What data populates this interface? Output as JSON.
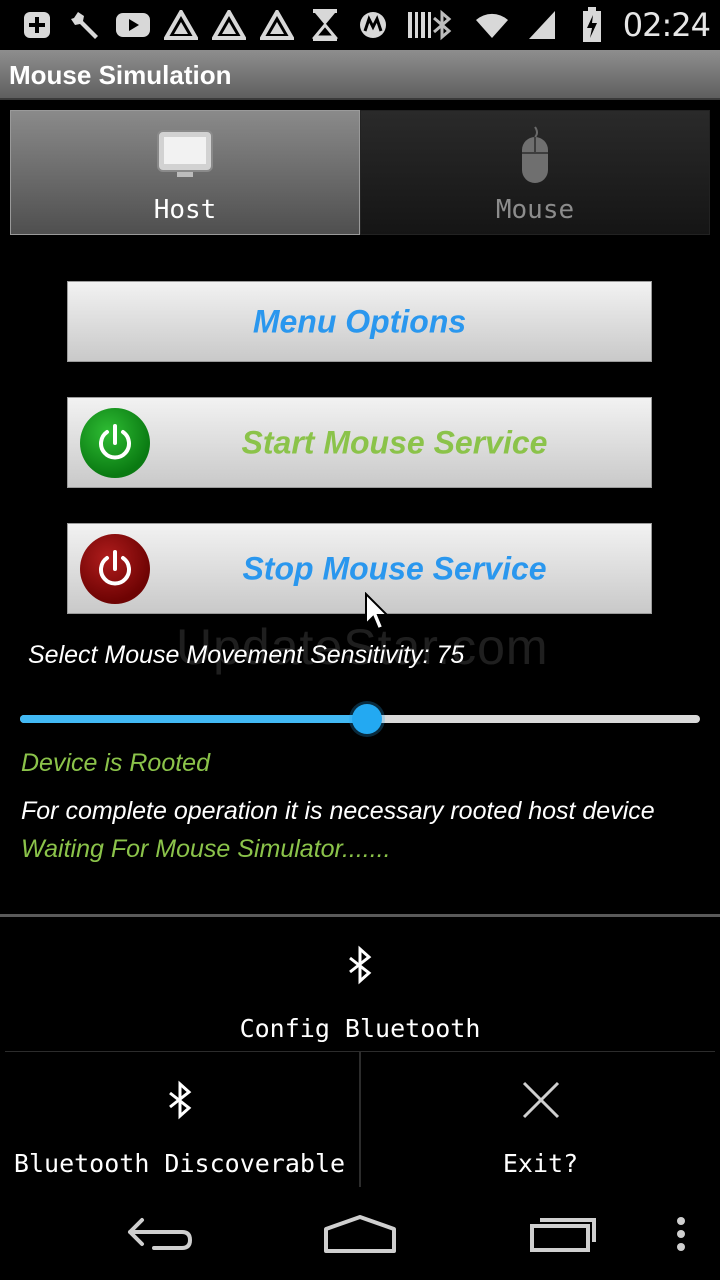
{
  "statusbar": {
    "time": "02:24",
    "left_icons": [
      "add-icon",
      "wrench-icon",
      "youtube-icon",
      "triangle-icon",
      "triangle-icon",
      "triangle-icon",
      "hourglass-icon",
      "motorola-icon",
      "barcode-icon"
    ],
    "right_icons": [
      "bluetooth-icon",
      "wifi-icon",
      "signal-icon",
      "battery-charging-icon"
    ]
  },
  "app": {
    "title": "Mouse Simulation"
  },
  "tabs": [
    {
      "label": "Host",
      "icon": "monitor-icon",
      "selected": true
    },
    {
      "label": "Mouse",
      "icon": "mouse-icon",
      "selected": false
    }
  ],
  "buttons": {
    "menu_options": "Menu Options",
    "start_service": "Start Mouse Service",
    "stop_service": "Stop Mouse Service"
  },
  "colors": {
    "accent_blue": "#2a97ee",
    "accent_green": "#8bc34a",
    "slider_blue": "#42b9f4"
  },
  "watermark": "UpdateStar.com",
  "sensitivity": {
    "label": "Select Mouse Movement Sensitivity: 75",
    "fraction": 0.51
  },
  "status": {
    "rooted": "Device is Rooted",
    "info": "For complete operation it is necessary rooted host device",
    "waiting": "Waiting For Mouse Simulator......."
  },
  "menu": {
    "config_bluetooth": "Config Bluetooth",
    "bluetooth_discoverable": "Bluetooth Discoverable",
    "exit": "Exit?"
  },
  "navbar": {
    "icons": [
      "back-icon",
      "home-icon",
      "recent-apps-icon",
      "overflow-menu-icon"
    ]
  }
}
